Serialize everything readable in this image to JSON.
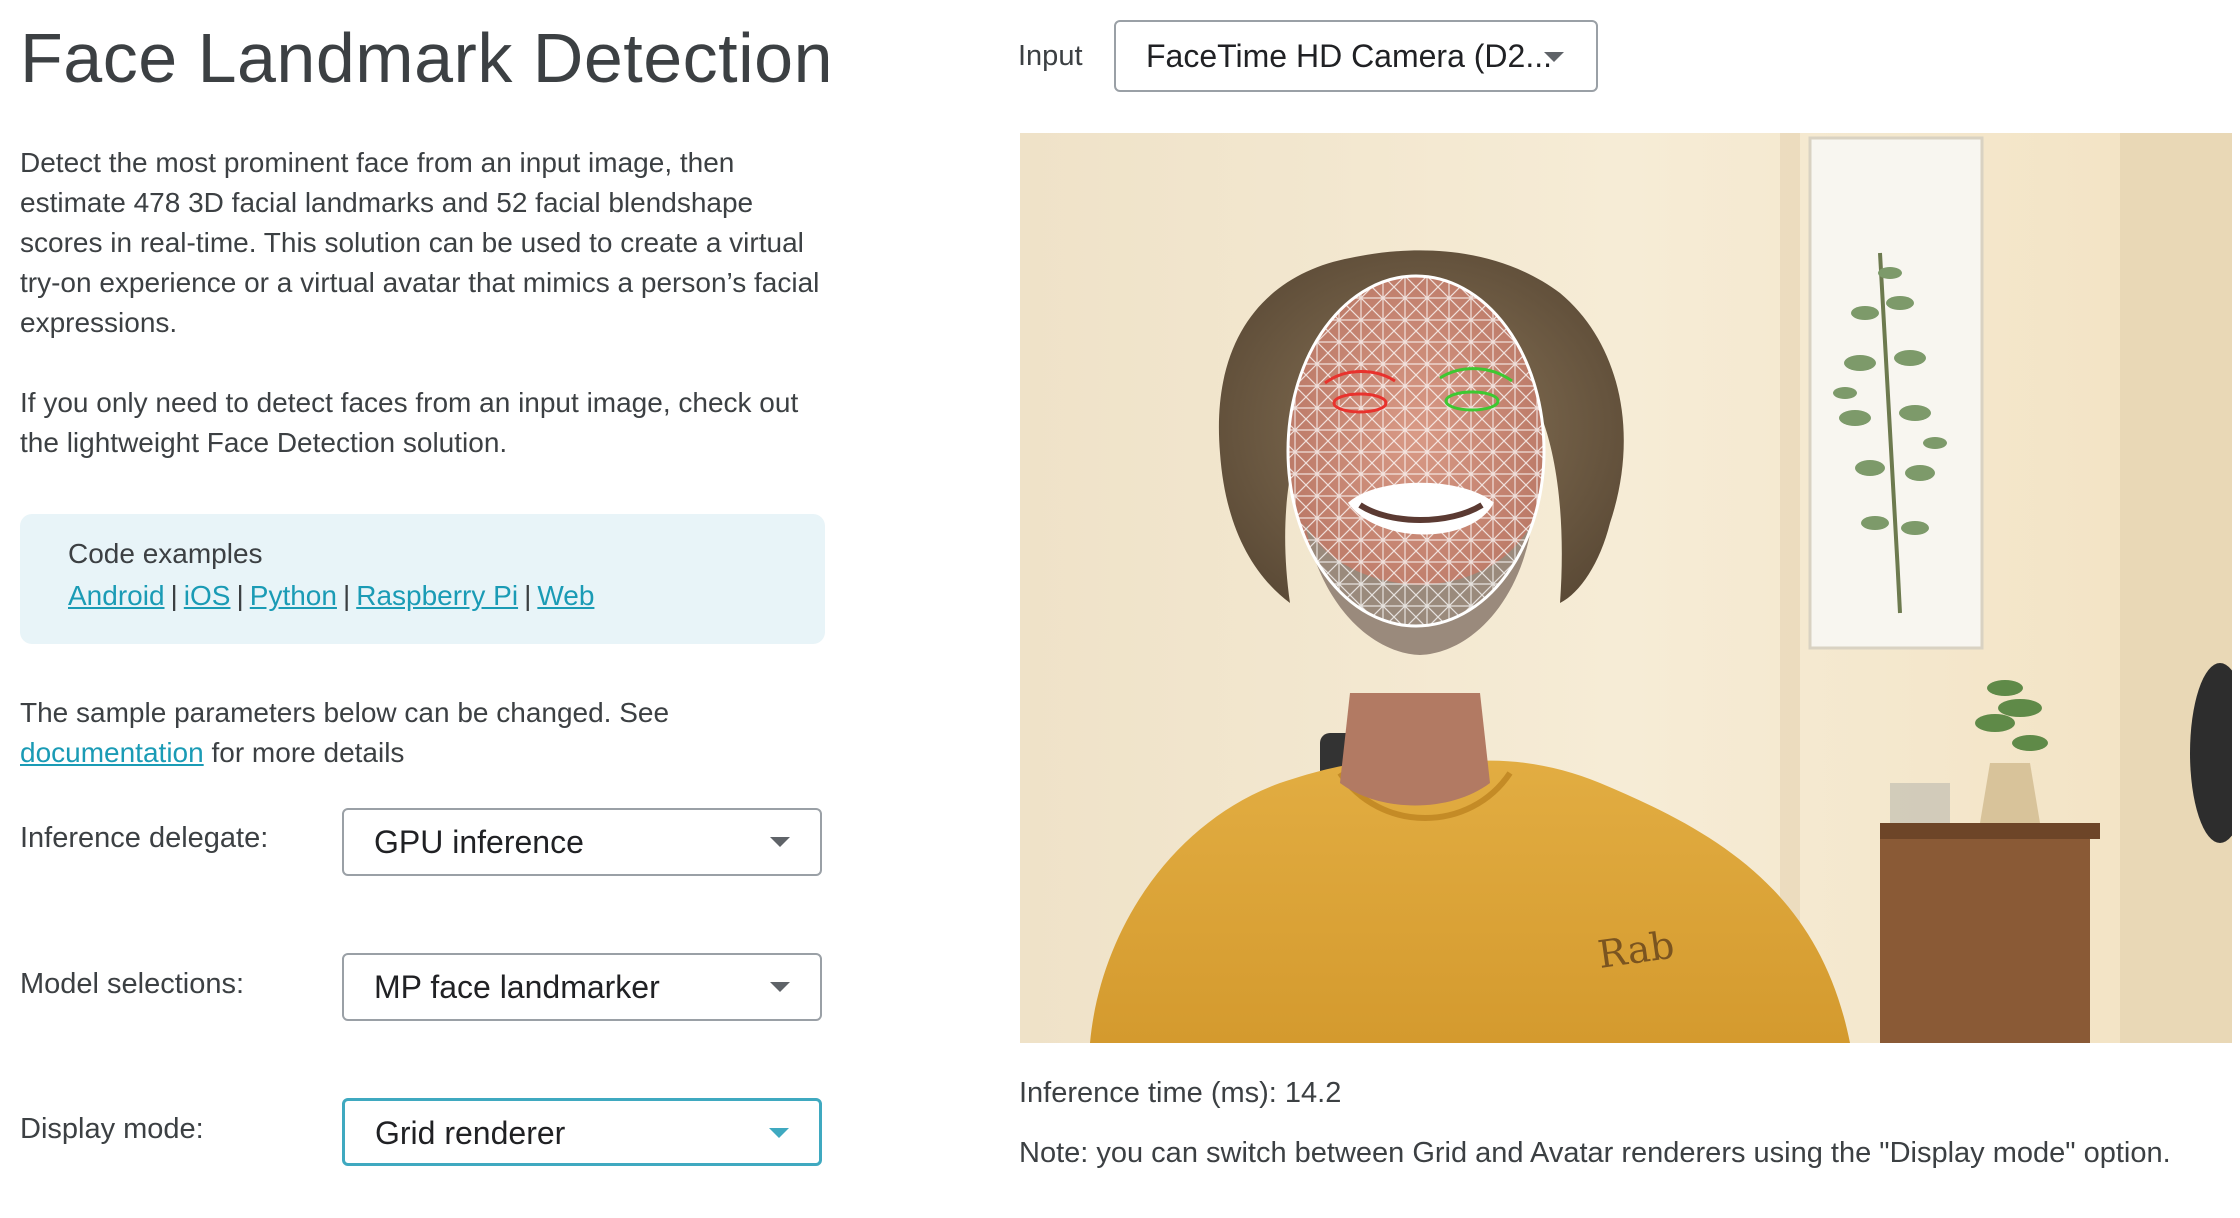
{
  "title": "Face Landmark Detection",
  "description": {
    "paragraph_1": "Detect the most prominent face from an input image, then estimate 478 3D facial landmarks and 52 facial blendshape scores in real-time. This solution can be used to create a virtual try-on experience or a virtual avatar that mimics a person’s facial expressions.",
    "paragraph_2": "If you only need to detect faces from an input image, check out the lightweight Face Detection solution."
  },
  "code_examples": {
    "title": "Code examples",
    "separator": "|",
    "links": [
      "Android",
      "iOS",
      "Python",
      "Raspberry Pi",
      "Web"
    ]
  },
  "params_intro": {
    "before": "The sample parameters below can be changed. See ",
    "link": "documentation",
    "after": " for more details"
  },
  "params": {
    "delegate": {
      "label": "Inference delegate:",
      "value": "GPU inference"
    },
    "model": {
      "label": "Model selections:",
      "value": "MP face landmarker"
    },
    "display": {
      "label": "Display mode:",
      "value": "Grid renderer"
    }
  },
  "input": {
    "label": "Input",
    "value": "FaceTime HD Camera (D2..."
  },
  "shirt_logo": "Rab",
  "inference_time": "Inference time (ms): 14.2",
  "note": "Note: you can switch between Grid and Avatar renderers using the \"Display mode\" option.",
  "colors": {
    "link": "#1a9bb5",
    "code_box_bg": "#e8f4f8",
    "focus_border": "#3fa9c0",
    "text": "#3c4043",
    "shirt": "#dfa93d",
    "mesh": "#ffffff",
    "right_eye_mesh": "#e8322d",
    "left_eye_mesh": "#3ec832"
  },
  "icons": {
    "dropdown": "chevron-down-icon"
  }
}
